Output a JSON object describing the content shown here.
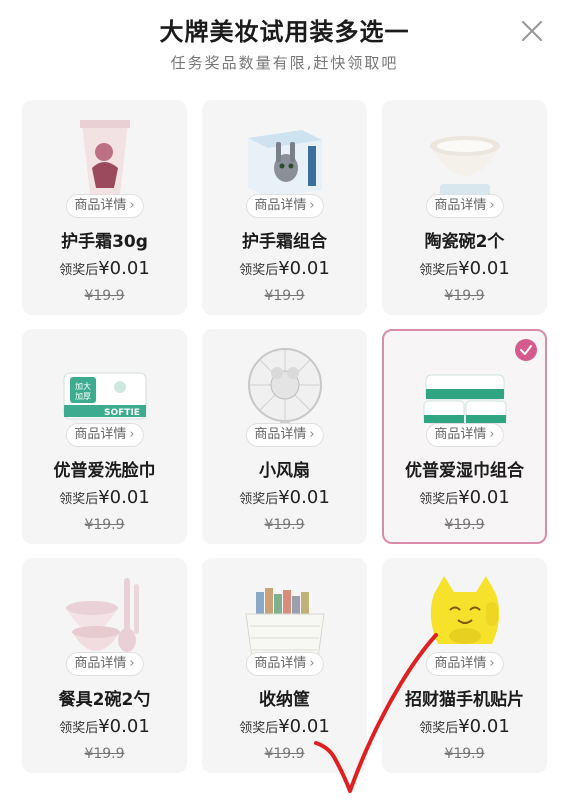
{
  "header": {
    "title": "大牌美妆试用装多选一",
    "subtitle": "任务奖品数量有限,赶快领取吧"
  },
  "products": [
    {
      "name": "护手霜30g",
      "detail_label": "商品详情",
      "price_label": "领奖后",
      "price": "¥0.01",
      "original_price": "¥19.9",
      "selected": false,
      "icon": "hand-cream-tube"
    },
    {
      "name": "护手霜组合",
      "detail_label": "商品详情",
      "price_label": "领奖后",
      "price": "¥0.01",
      "original_price": "¥19.9",
      "selected": false,
      "icon": "hand-cream-gift-box"
    },
    {
      "name": "陶瓷碗2个",
      "detail_label": "商品详情",
      "price_label": "领奖后",
      "price": "¥0.01",
      "original_price": "¥19.9",
      "selected": false,
      "icon": "ceramic-bowl"
    },
    {
      "name": "优普爱洗脸巾",
      "detail_label": "商品详情",
      "price_label": "领奖后",
      "price": "¥0.01",
      "original_price": "¥19.9",
      "selected": false,
      "icon": "face-towel-pack",
      "pack_text": [
        "加大",
        "加厚",
        "SOFTIE"
      ]
    },
    {
      "name": "小风扇",
      "detail_label": "商品详情",
      "price_label": "领奖后",
      "price": "¥0.01",
      "original_price": "¥19.9",
      "selected": false,
      "icon": "desk-fan"
    },
    {
      "name": "优普爱湿巾组合",
      "detail_label": "商品详情",
      "price_label": "领奖后",
      "price": "¥0.01",
      "original_price": "¥19.9",
      "selected": true,
      "icon": "wet-wipes-set"
    },
    {
      "name": "餐具2碗2勺",
      "detail_label": "商品详情",
      "price_label": "领奖后",
      "price": "¥0.01",
      "original_price": "¥19.9",
      "selected": false,
      "icon": "bowls-and-spoons"
    },
    {
      "name": "收纳筐",
      "detail_label": "商品详情",
      "price_label": "领奖后",
      "price": "¥0.01",
      "original_price": "¥19.9",
      "selected": false,
      "icon": "storage-basket"
    },
    {
      "name": "招财猫手机贴片",
      "detail_label": "商品详情",
      "price_label": "领奖后",
      "price": "¥0.01",
      "original_price": "¥19.9",
      "selected": false,
      "icon": "lucky-cat-sticker"
    }
  ],
  "colors": {
    "selected_border": "#d98ca9",
    "check_badge": "#d45b8c",
    "card_bg": "#f5f5f6",
    "hand_drawn_mark": "#e02020"
  }
}
